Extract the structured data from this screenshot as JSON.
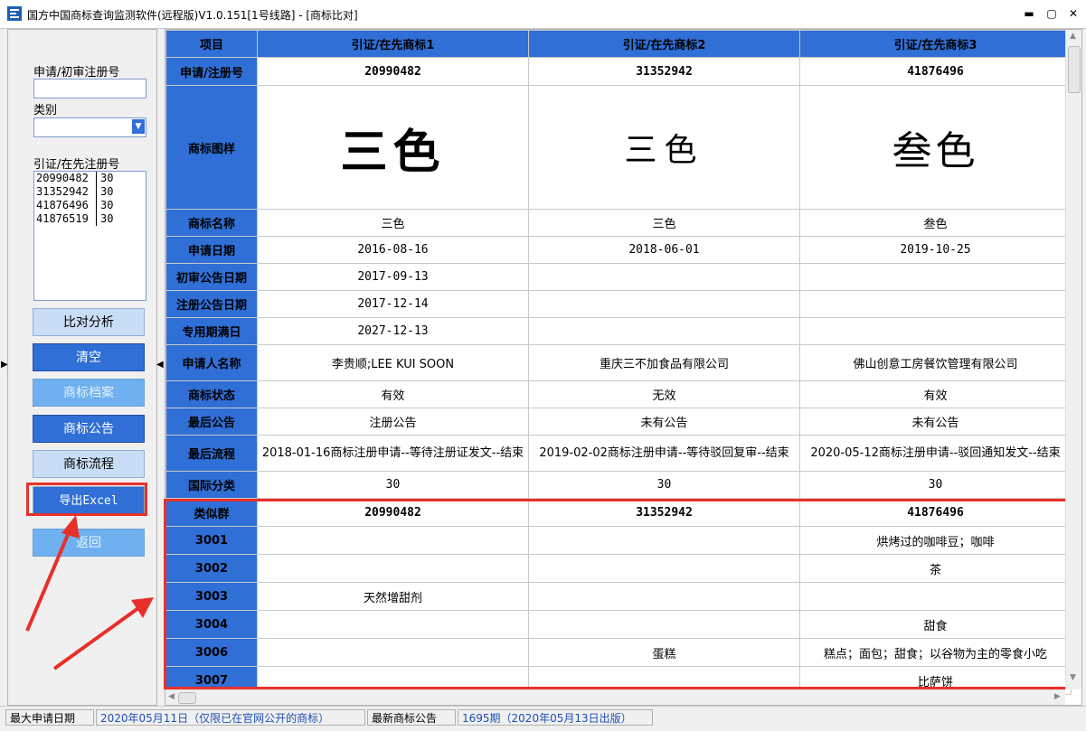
{
  "window": {
    "title": "国方中国商标查询监测软件(远程版)V1.0.151[1号线路] - [商标比对]",
    "minimize": "▬",
    "maximize": "▢",
    "close": "✕"
  },
  "left": {
    "reg_label": "申请/初审注册号",
    "reg_value": "",
    "class_label": "类别",
    "class_value": "",
    "cited_label": "引证/在先注册号",
    "cited_list": [
      {
        "num": "20990482",
        "cls": "30"
      },
      {
        "num": "31352942",
        "cls": "30"
      },
      {
        "num": "41876496",
        "cls": "30"
      },
      {
        "num": "41876519",
        "cls": "30"
      }
    ],
    "buttons": {
      "compare": "比对分析",
      "clear": "清空",
      "archive": "商标档案",
      "announce": "商标公告",
      "flow": "商标流程",
      "export": "导出Excel",
      "back": "返回"
    }
  },
  "table": {
    "headers": [
      "项目",
      "引证/在先商标1",
      "引证/在先商标2",
      "引证/在先商标3"
    ],
    "rows": [
      {
        "label": "申请/注册号",
        "v": [
          "20990482",
          "31352942",
          "41876496"
        ],
        "style": "bold"
      },
      {
        "label": "商标图样",
        "v": [
          "三色",
          "三色",
          "叁色"
        ],
        "style": "logo"
      },
      {
        "label": "商标名称",
        "v": [
          "三色",
          "三色",
          "叁色"
        ]
      },
      {
        "label": "申请日期",
        "v": [
          "2016-08-16",
          "2018-06-01",
          "2019-10-25"
        ],
        "style": "mono"
      },
      {
        "label": "初审公告日期",
        "v": [
          "2017-09-13",
          "",
          ""
        ],
        "style": "mono"
      },
      {
        "label": "注册公告日期",
        "v": [
          "2017-12-14",
          "",
          ""
        ],
        "style": "mono"
      },
      {
        "label": "专用期满日",
        "v": [
          "2027-12-13",
          "",
          ""
        ],
        "style": "mono"
      },
      {
        "label": "申请人名称",
        "v": [
          "李贵顺;LEE KUI SOON",
          "重庆三不加食品有限公司",
          "佛山创意工房餐饮管理有限公司"
        ]
      },
      {
        "label": "商标状态",
        "v": [
          "有效",
          "无效",
          "有效"
        ]
      },
      {
        "label": "最后公告",
        "v": [
          "注册公告",
          "未有公告",
          "未有公告"
        ]
      },
      {
        "label": "最后流程",
        "v": [
          "2018-01-16商标注册申请--等待注册证发文--结束",
          "2019-02-02商标注册申请--等待驳回复审--结束",
          "2020-05-12商标注册申请--驳回通知发文--结束"
        ],
        "style": "wrap"
      },
      {
        "label": "国际分类",
        "v": [
          "30",
          "30",
          "30"
        ],
        "style": "mono"
      },
      {
        "label": "类似群",
        "v": [
          "20990482",
          "31352942",
          "41876496"
        ],
        "style": "bold"
      },
      {
        "label": "3001",
        "v": [
          "",
          "",
          "烘烤过的咖啡豆；咖啡"
        ]
      },
      {
        "label": "3002",
        "v": [
          "",
          "",
          "茶"
        ]
      },
      {
        "label": "3003",
        "v": [
          "天然增甜剂",
          "",
          ""
        ]
      },
      {
        "label": "3004",
        "v": [
          "",
          "",
          "甜食"
        ]
      },
      {
        "label": "3006",
        "v": [
          "",
          "蛋糕",
          "糕点；面包；甜食；以谷物为主的零食小吃"
        ]
      },
      {
        "label": "3007",
        "v": [
          "",
          "",
          "比萨饼"
        ]
      }
    ]
  },
  "status": {
    "max_date_label": "最大申请日期",
    "max_date_value": "2020年05月11日（仅限已在官网公开的商标）",
    "latest_label": "最新商标公告",
    "latest_value": "1695期（2020年05月13日出版）"
  },
  "colors": {
    "header_blue": "#2f6fd6",
    "highlight_red": "#e8302a"
  }
}
